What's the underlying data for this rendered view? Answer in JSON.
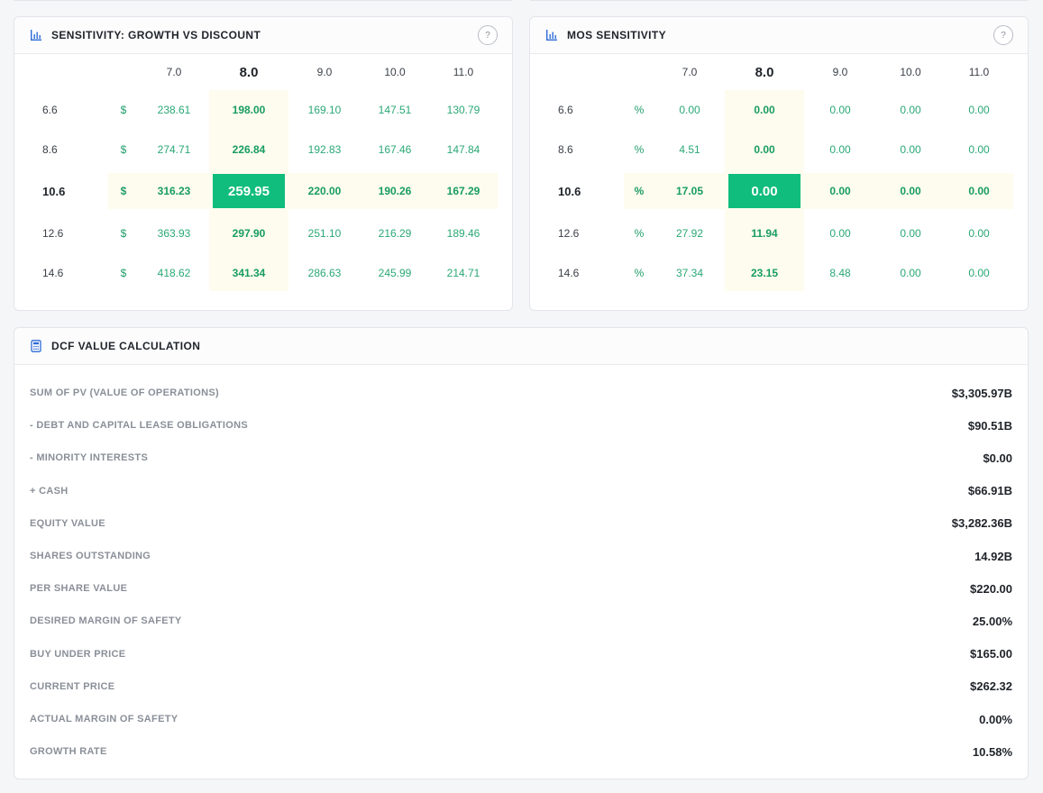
{
  "sensitivity": {
    "title": "SENSITIVITY: GROWTH VS DISCOUNT",
    "help": "?",
    "unit": "$",
    "columns": [
      "7.0",
      "8.0",
      "9.0",
      "10.0",
      "11.0"
    ],
    "rows": [
      {
        "label": "6.6",
        "values": [
          "238.61",
          "198.00",
          "169.10",
          "147.51",
          "130.79"
        ]
      },
      {
        "label": "8.6",
        "values": [
          "274.71",
          "226.84",
          "192.83",
          "167.46",
          "147.84"
        ]
      },
      {
        "label": "10.6",
        "values": [
          "316.23",
          "259.95",
          "220.00",
          "190.26",
          "167.29"
        ]
      },
      {
        "label": "12.6",
        "values": [
          "363.93",
          "297.90",
          "251.10",
          "216.29",
          "189.46"
        ]
      },
      {
        "label": "14.6",
        "values": [
          "418.62",
          "341.34",
          "286.63",
          "245.99",
          "214.71"
        ]
      }
    ]
  },
  "mos": {
    "title": "MOS SENSITIVITY",
    "help": "?",
    "unit": "%",
    "columns": [
      "7.0",
      "8.0",
      "9.0",
      "10.0",
      "11.0"
    ],
    "rows": [
      {
        "label": "6.6",
        "values": [
          "0.00",
          "0.00",
          "0.00",
          "0.00",
          "0.00"
        ]
      },
      {
        "label": "8.6",
        "values": [
          "4.51",
          "0.00",
          "0.00",
          "0.00",
          "0.00"
        ]
      },
      {
        "label": "10.6",
        "values": [
          "17.05",
          "0.00",
          "0.00",
          "0.00",
          "0.00"
        ]
      },
      {
        "label": "12.6",
        "values": [
          "27.92",
          "11.94",
          "0.00",
          "0.00",
          "0.00"
        ]
      },
      {
        "label": "14.6",
        "values": [
          "37.34",
          "23.15",
          "8.48",
          "0.00",
          "0.00"
        ]
      }
    ]
  },
  "dcf": {
    "title": "DCF VALUE CALCULATION",
    "items": [
      {
        "label": "SUM OF PV (VALUE OF OPERATIONS)",
        "value": "$3,305.97B"
      },
      {
        "label": "- DEBT AND CAPITAL LEASE OBLIGATIONS",
        "value": "$90.51B"
      },
      {
        "label": "- MINORITY INTERESTS",
        "value": "$0.00"
      },
      {
        "label": "+ CASH",
        "value": "$66.91B"
      },
      {
        "label": "EQUITY VALUE",
        "value": "$3,282.36B"
      },
      {
        "label": "SHARES OUTSTANDING",
        "value": "14.92B"
      },
      {
        "label": "PER SHARE VALUE",
        "value": "$220.00"
      },
      {
        "label": "DESIRED MARGIN OF SAFETY",
        "value": "25.00%"
      },
      {
        "label": "BUY UNDER PRICE",
        "value": "$165.00"
      },
      {
        "label": "CURRENT PRICE",
        "value": "$262.32"
      },
      {
        "label": "ACTUAL MARGIN OF SAFETY",
        "value": "0.00%"
      },
      {
        "label": "GROWTH RATE",
        "value": "10.58%"
      }
    ]
  },
  "colors": {
    "accent_green": "#10bd7c",
    "value_green": "#2aa876",
    "highlight_band": "#fefcee",
    "icon_blue": "#2e6bd6"
  }
}
